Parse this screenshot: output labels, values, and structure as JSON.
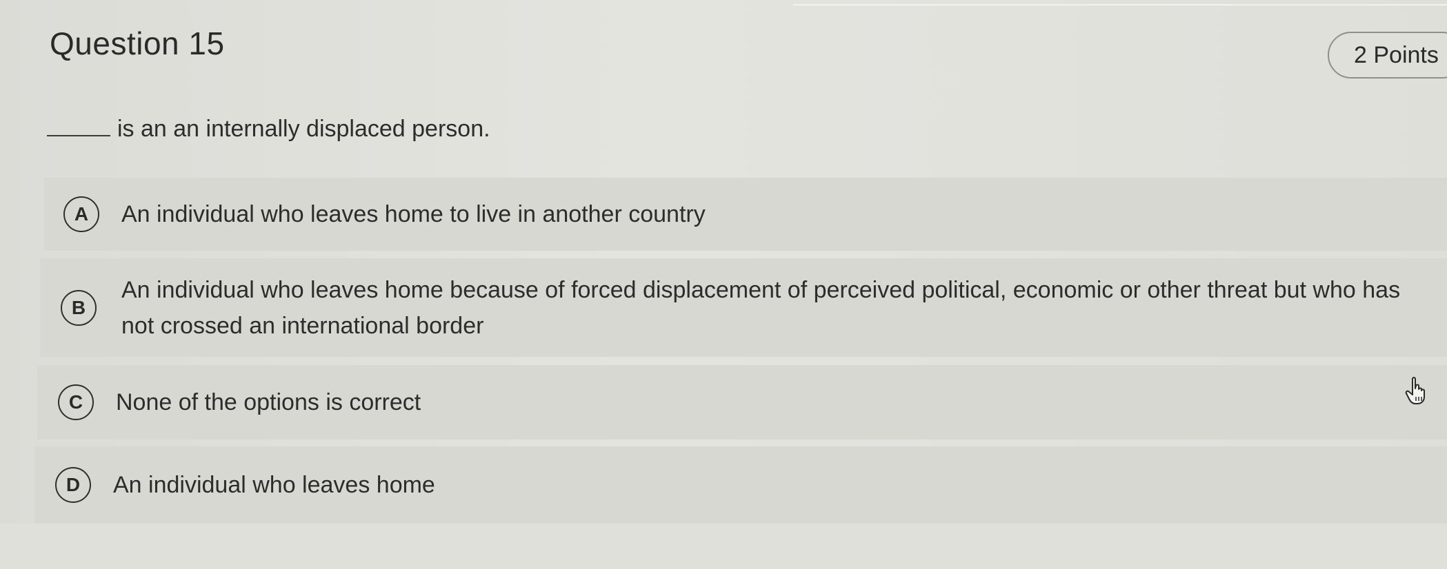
{
  "question": {
    "title": "Question 15",
    "points": "2 Points",
    "prompt_text": "is an an internally displaced person."
  },
  "options": [
    {
      "letter": "A",
      "text": "An individual who leaves home to live in another country"
    },
    {
      "letter": "B",
      "text": "An individual who leaves home because of forced displacement of perceived political, economic or other threat but who has not crossed an international border"
    },
    {
      "letter": "C",
      "text": "None of the options is correct"
    },
    {
      "letter": "D",
      "text": "An individual who leaves home"
    }
  ],
  "icons": {
    "cursor": "hand-pointer-icon"
  }
}
